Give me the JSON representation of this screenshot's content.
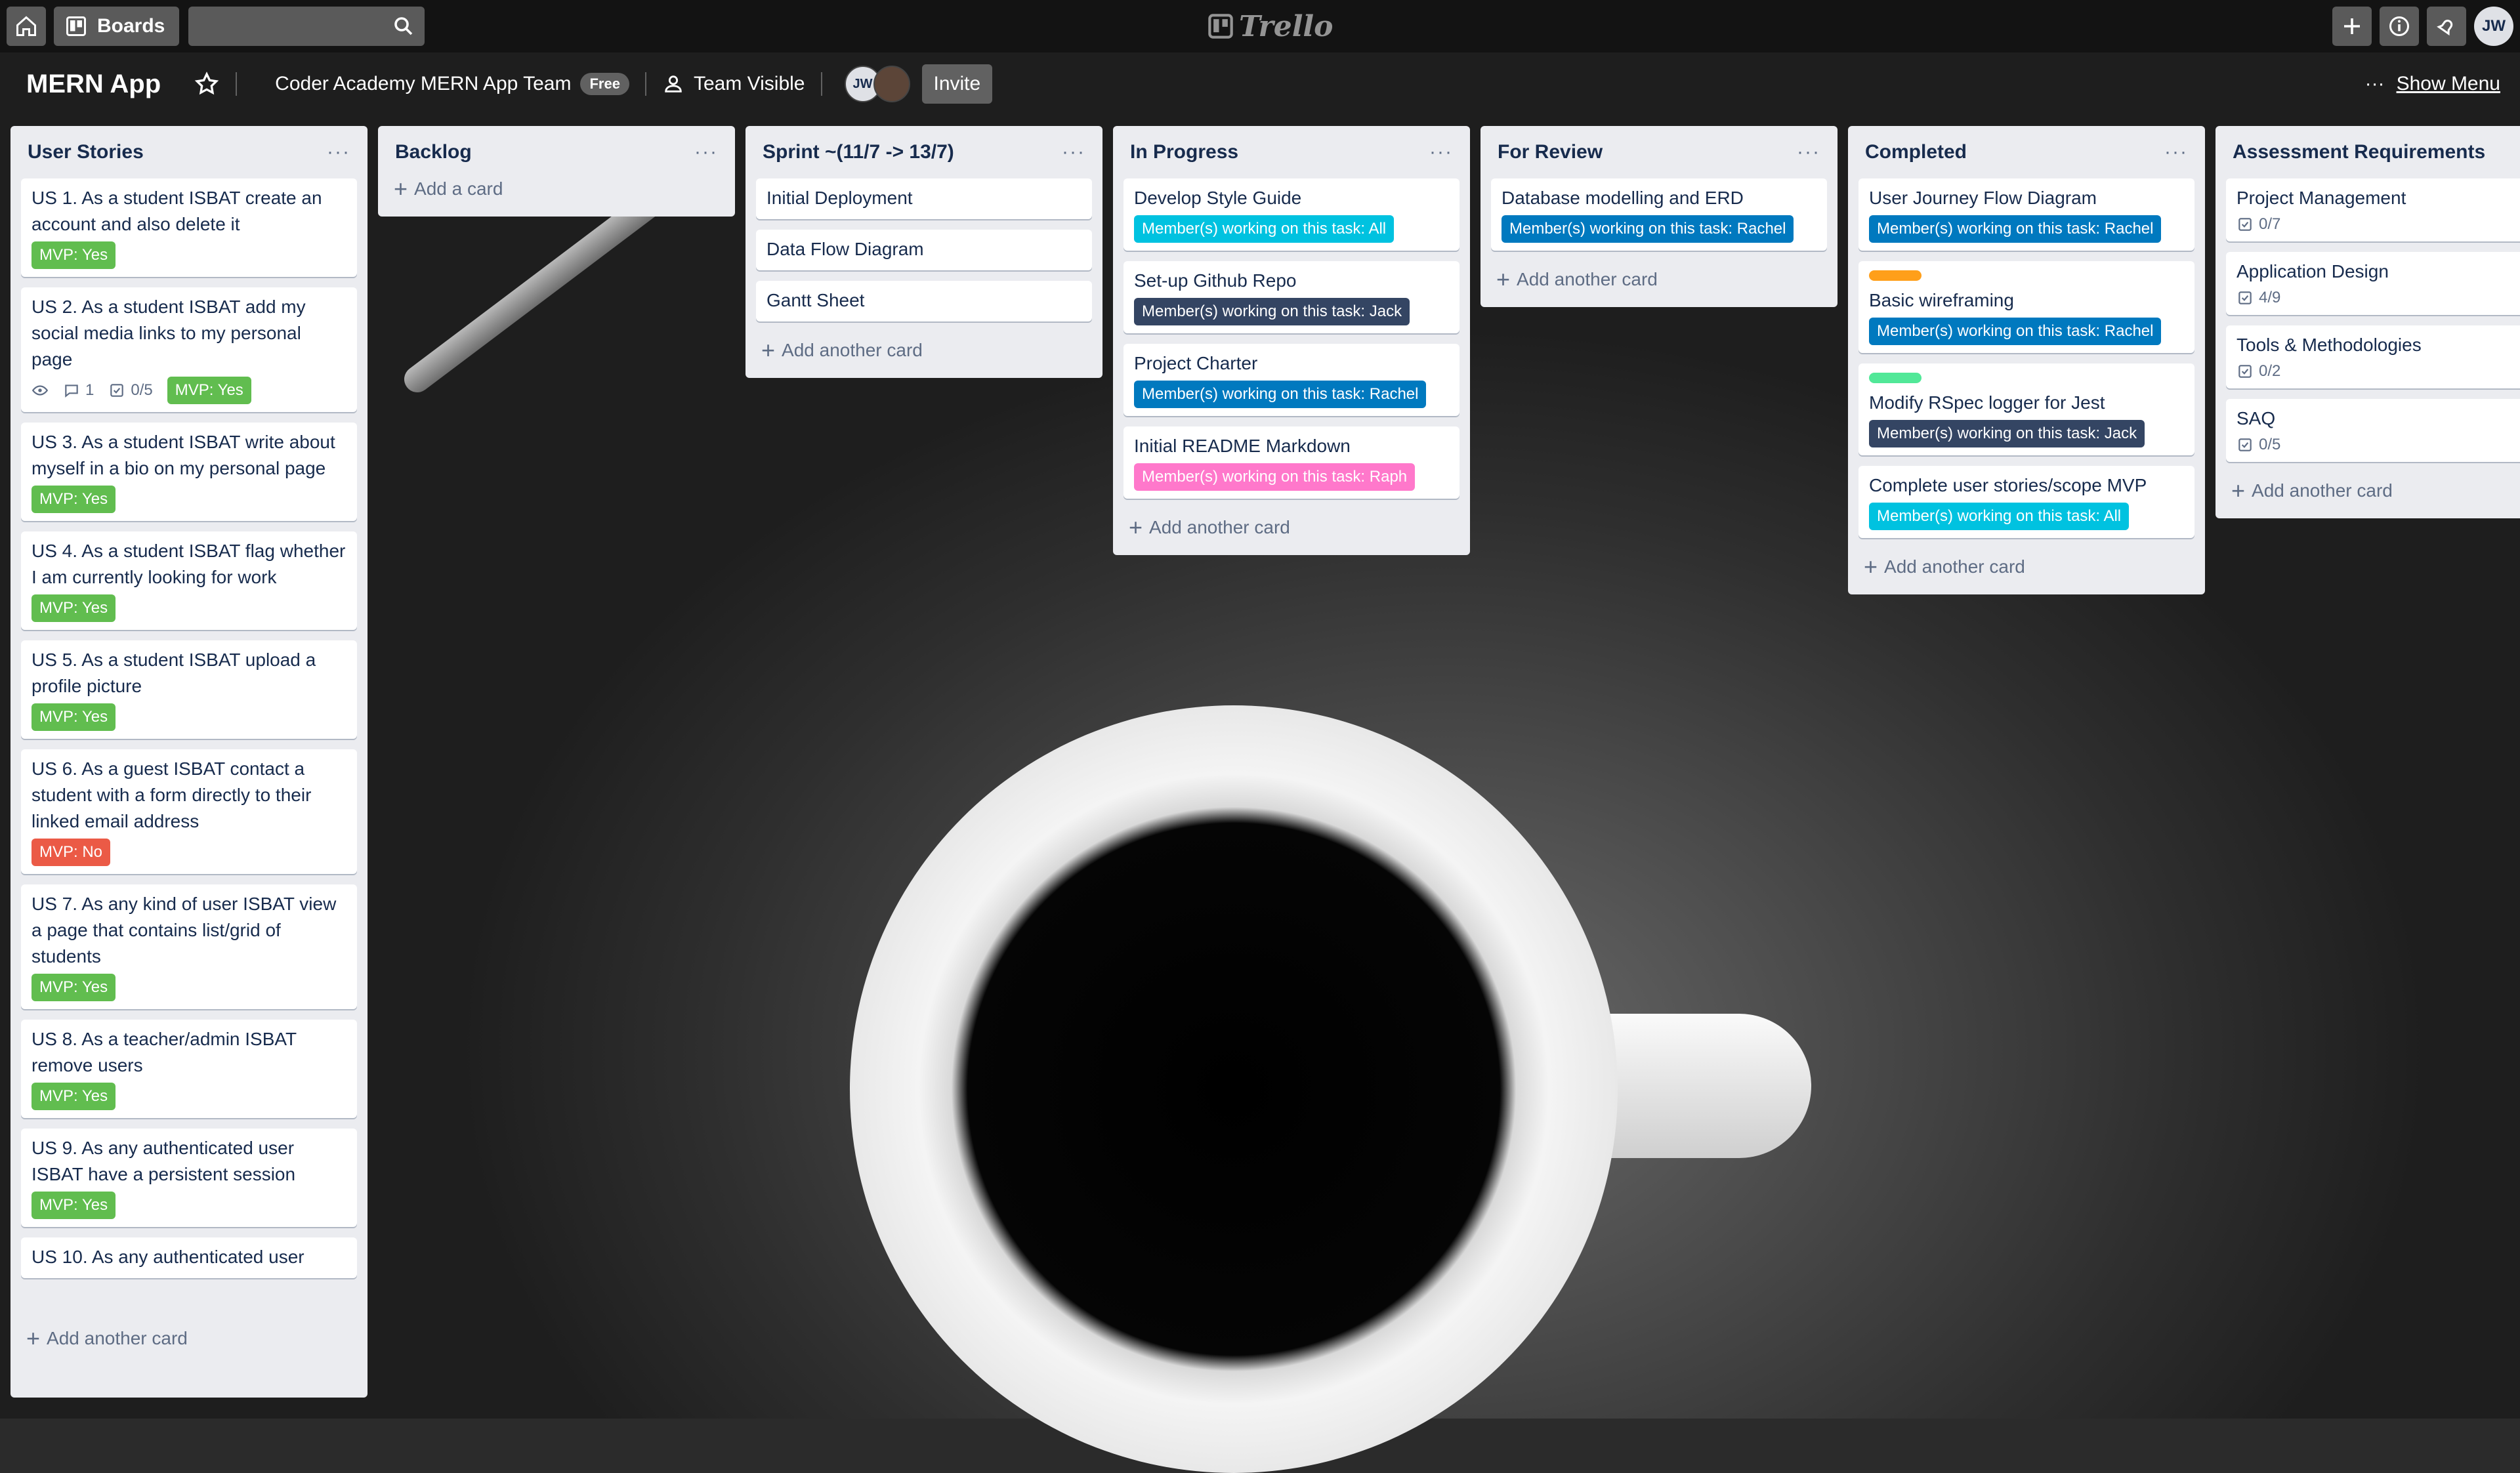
{
  "header": {
    "boards_label": "Boards",
    "search_value": "",
    "logo_text": "Trello",
    "avatar_initials": "JW"
  },
  "board": {
    "title": "MERN App",
    "team": "Coder Academy MERN App Team",
    "team_badge": "Free",
    "visibility": "Team Visible",
    "member_initials": "JW",
    "invite_label": "Invite",
    "show_menu_label": "Show Menu"
  },
  "lists": [
    {
      "title": "User Stories",
      "add_label": "Add another card",
      "cards": [
        {
          "title": "US 1. As a student ISBAT create an account and also delete it",
          "label": "MVP: Yes"
        },
        {
          "title": "US 2. As a student ISBAT add my social media links to my personal page",
          "label": "MVP: Yes",
          "comments": "1",
          "checklist": "0/5"
        },
        {
          "title": "US 3. As a student ISBAT write about myself in a bio on my personal page",
          "label": "MVP: Yes"
        },
        {
          "title": "US 4. As a student ISBAT flag whether I am currently looking for work",
          "label": "MVP: Yes"
        },
        {
          "title": "US 5. As a student ISBAT upload a profile picture",
          "label": "MVP: Yes"
        },
        {
          "title": "US 6. As a guest ISBAT contact a student with a form directly to their linked email address",
          "label": "MVP: No"
        },
        {
          "title": "US 7. As any kind of user ISBAT view a page that contains list/grid of students",
          "label": "MVP: Yes"
        },
        {
          "title": "US 8. As a teacher/admin ISBAT remove users",
          "label": "MVP: Yes"
        },
        {
          "title": "US 9. As any authenticated user ISBAT have a persistent session",
          "label": "MVP: Yes"
        },
        {
          "title": "US 10. As any authenticated user"
        }
      ]
    },
    {
      "title": "Backlog",
      "add_label": "Add a card",
      "cards": []
    },
    {
      "title": "Sprint ~(11/7 -> 13/7)",
      "add_label": "Add another card",
      "cards": [
        {
          "title": "Initial Deployment"
        },
        {
          "title": "Data Flow Diagram"
        },
        {
          "title": "Gantt Sheet"
        }
      ]
    },
    {
      "title": "In Progress",
      "add_label": "Add another card",
      "cards": [
        {
          "title": "Develop Style Guide",
          "label": "Member(s) working on this task: All"
        },
        {
          "title": "Set-up Github Repo",
          "label": "Member(s) working on this task: Jack"
        },
        {
          "title": "Project Charter",
          "label": "Member(s) working on this task: Rachel"
        },
        {
          "title": "Initial README Markdown",
          "label": "Member(s) working on this task: Raph"
        }
      ]
    },
    {
      "title": "For Review",
      "add_label": "Add another card",
      "cards": [
        {
          "title": "Database modelling and ERD",
          "label": "Member(s) working on this task: Rachel"
        }
      ]
    },
    {
      "title": "Completed",
      "add_label": "Add another card",
      "cards": [
        {
          "title": "User Journey Flow Diagram",
          "label": "Member(s) working on this task: Rachel"
        },
        {
          "title": "Basic wireframing",
          "label": "Member(s) working on this task: Rachel"
        },
        {
          "title": "Modify RSpec logger for Jest",
          "label": "Member(s) working on this task: Jack"
        },
        {
          "title": "Complete user stories/scope MVP",
          "label": "Member(s) working on this task: All"
        }
      ]
    },
    {
      "title": "Assessment Requirements",
      "add_label": "Add another card",
      "cards": [
        {
          "title": "Project Management",
          "checklist": "0/7"
        },
        {
          "title": "Application Design",
          "checklist": "4/9"
        },
        {
          "title": "Tools & Methodologies",
          "checklist": "0/2"
        },
        {
          "title": "SAQ",
          "checklist": "0/5"
        }
      ]
    }
  ],
  "colors": {
    "green": "#61bd4f",
    "red": "#eb5a46",
    "sky": "#00c2e0",
    "blue": "#0079bf",
    "black": "#344563",
    "pink": "#ff78cb",
    "orange": "#ff9f1a",
    "lime": "#51e898"
  }
}
